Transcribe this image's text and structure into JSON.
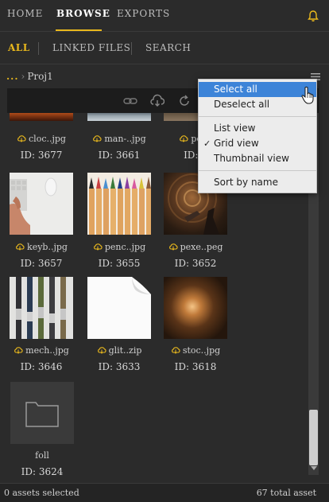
{
  "nav": {
    "tabs": [
      "HOME",
      "BROWSE",
      "EXPORTS"
    ],
    "active_tab": "BROWSE"
  },
  "subnav": {
    "tabs": [
      "ALL",
      "LINKED FILES",
      "SEARCH"
    ],
    "active_tab": "ALL"
  },
  "breadcrumb": {
    "ellipsis": "...",
    "separator": "›",
    "folder": "Proj1"
  },
  "menu": {
    "items": [
      "Select all",
      "Deselect all",
      "List view",
      "Grid view",
      "Thumbnail view",
      "Sort by name"
    ],
    "highlighted": "Select all",
    "checked": "Grid view",
    "check_glyph": "✓"
  },
  "assets": [
    {
      "name": "cloc..jpg",
      "id": "ID: 3677"
    },
    {
      "name": "man-..jpg",
      "id": "ID: 3661"
    },
    {
      "name": "pexe",
      "id": "ID: 3"
    },
    {
      "name": "keyb..jpg",
      "id": "ID: 3657"
    },
    {
      "name": "penc..jpg",
      "id": "ID: 3655"
    },
    {
      "name": "pexe..peg",
      "id": "ID: 3652"
    },
    {
      "name": "mech..jpg",
      "id": "ID: 3646"
    },
    {
      "name": "glit..zip",
      "id": "ID: 3633"
    },
    {
      "name": "stoc..jpg",
      "id": "ID: 3618"
    },
    {
      "name": "foll",
      "id": "ID: 3624"
    }
  ],
  "footer": {
    "selected": "0 assets selected",
    "total": "67 total asset"
  },
  "colors": {
    "accent": "#e9b81d",
    "menu_highlight": "#3d84d8",
    "background": "#2b2b2b"
  },
  "icons": [
    "bell-icon",
    "hamburger-icon",
    "link-icon",
    "cloud-download-icon",
    "refresh-icon",
    "cloud-icon",
    "folder-icon",
    "pointer-cursor-icon"
  ]
}
